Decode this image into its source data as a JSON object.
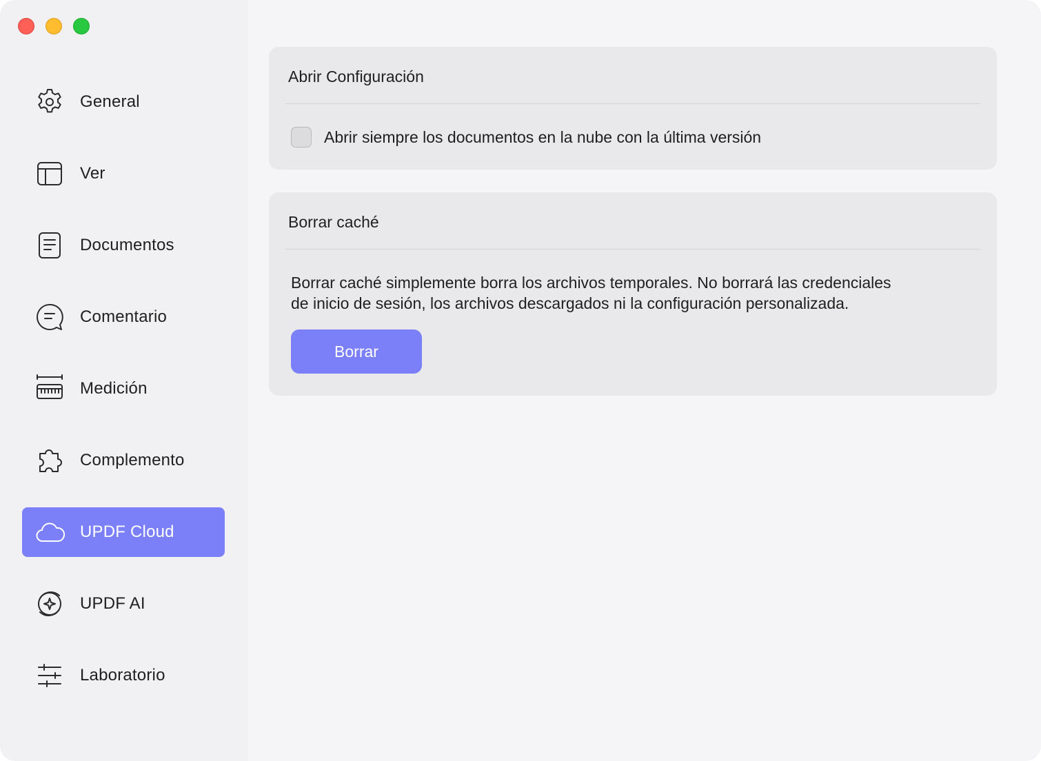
{
  "window": {
    "controls": [
      "close",
      "minimize",
      "zoom"
    ]
  },
  "sidebar": {
    "items": [
      {
        "label": "General",
        "icon": "gear-icon",
        "active": false
      },
      {
        "label": "Ver",
        "icon": "layout-icon",
        "active": false
      },
      {
        "label": "Documentos",
        "icon": "document-icon",
        "active": false
      },
      {
        "label": "Comentario",
        "icon": "comment-icon",
        "active": false
      },
      {
        "label": "Medición",
        "icon": "ruler-icon",
        "active": false
      },
      {
        "label": "Complemento",
        "icon": "puzzle-icon",
        "active": false
      },
      {
        "label": "UPDF Cloud",
        "icon": "cloud-icon",
        "active": true
      },
      {
        "label": "UPDF AI",
        "icon": "ai-sparkle-icon",
        "active": false
      },
      {
        "label": "Laboratorio",
        "icon": "sliders-icon",
        "active": false
      }
    ]
  },
  "open_settings": {
    "title": "Abrir Configuración",
    "checkbox_label": "Abrir siempre los documentos en la nube con la última versión",
    "checked": false
  },
  "clear_cache": {
    "title": "Borrar caché",
    "description_line1": "Borrar caché simplemente borra los archivos temporales. No borrará las credenciales",
    "description_line2": "de inicio de sesión, los archivos descargados ni la configuración personalizada.",
    "button_label": "Borrar"
  },
  "colors": {
    "accent": "#7b7ff8",
    "card_bg": "#e9e9eb",
    "window_bg": "#f5f5f7"
  }
}
